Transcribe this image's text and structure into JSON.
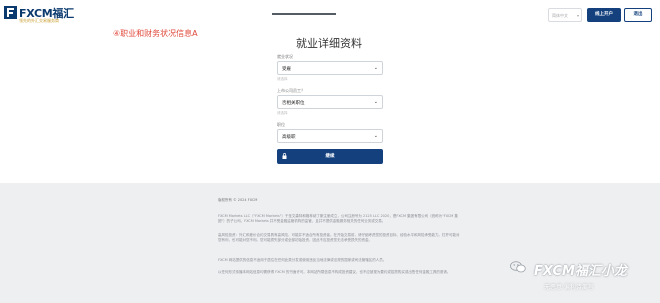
{
  "header": {
    "logo_text": "FXCM福汇",
    "logo_sub": "领先的外汇交易服务商",
    "progress_fraction": 1.0,
    "language_select_value": "简体中文",
    "login_button": "线上开户",
    "exit_button": "退出"
  },
  "annotation": "④职业和财务状况信息A",
  "form": {
    "title": "就业详细资料",
    "fields": [
      {
        "label": "就业状况",
        "value": "受雇",
        "hint": "请选择"
      },
      {
        "label": "上市公司员工？",
        "value": "否相关职位",
        "hint": "请选择"
      },
      {
        "label": "职位",
        "value": "高级职",
        "hint": ""
      }
    ],
    "submit_label": "继续"
  },
  "footer": {
    "copyright": "版权所有 © 2024 FXCM",
    "paragraphs": [
      "FXCM Markets LLC（\"FXCM Markets\"）于圣文森特和格林纳丁斯注册成立，公司注册号为 2125 LLC 2020，是FXCM 集团有限公司（统称为\"FXCM 集团\"）的子公司。FXCM Markets 并不受金融监管机构的监管，且并不提供金融服务相关的任何业务或交易。",
      "高风险投资：外汇和差价合约交易具有高风险，可能并不适合所有投资者。在开始交易前，请仔细考虑您的投资目标、经验水平和风险承受能力。杠杆可能对您有利，也可能对您不利。您可能损失部分或全部初始投资，因此不应投资您无法承受损失的资金。",
      "FXCM 网站提供的信息不适用于居住在任何此类分发或使用违反当地法律或法规的国家或司法管辖区的人员。",
      "以任何形式传播本网站信息均需获得 FXCM 的书面许可。本网站所载信息不构成投资建议，也不应被视为要约或招揽购买或出售任何金融工具的邀请。"
    ]
  },
  "watermark": {
    "title": "FXCM福汇小龙",
    "subtitle": "无恶意  偏利诗离写"
  }
}
